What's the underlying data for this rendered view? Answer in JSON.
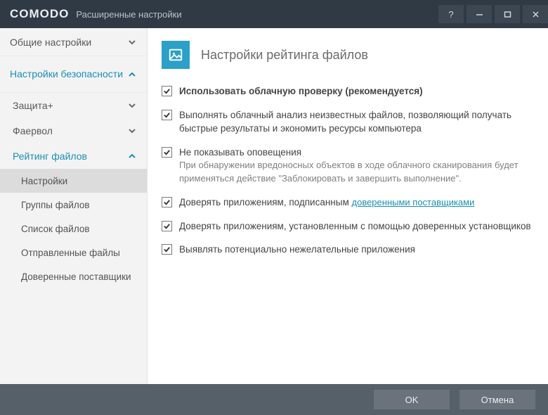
{
  "window": {
    "brand": "COMODO",
    "subtitle": "Расширенные настройки"
  },
  "sidebar": {
    "items": [
      {
        "label": "Общие настройки",
        "expanded": false,
        "active": false
      },
      {
        "label": "Настройки безопасности",
        "expanded": true,
        "active": true
      }
    ],
    "children": [
      {
        "label": "Защита+",
        "expanded": false,
        "active": false
      },
      {
        "label": "Фаервол",
        "expanded": false,
        "active": false
      },
      {
        "label": "Рейтинг файлов",
        "expanded": true,
        "active": true
      }
    ],
    "leaves": [
      {
        "label": "Настройки",
        "selected": true
      },
      {
        "label": "Группы файлов",
        "selected": false
      },
      {
        "label": "Список файлов",
        "selected": false
      },
      {
        "label": "Отправленные файлы",
        "selected": false
      },
      {
        "label": "Доверенные поставщики",
        "selected": false
      }
    ]
  },
  "page": {
    "title": "Настройки рейтинга файлов",
    "options": [
      {
        "label": "Использовать облачную проверку (рекомендуется)",
        "checked": true,
        "bold": true
      },
      {
        "label": "Выполнять облачный анализ неизвестных файлов, позволяющий получать быстрые результаты и экономить ресурсы компьютера",
        "checked": true
      },
      {
        "label": "Не показывать оповещения",
        "checked": true,
        "desc": "При обнаружении вредоносных объектов в ходе облачного сканирования будет применяться действие \"Заблокировать и завершить выполнение\"."
      },
      {
        "label_pre": "Доверять приложениям, подписанным ",
        "link": "доверенными поставщиками",
        "checked": true
      },
      {
        "label": "Доверять приложениям, установленным с помощью доверенных установщиков",
        "checked": true
      },
      {
        "label": "Выявлять потенциально нежелательные приложения",
        "checked": true
      }
    ]
  },
  "footer": {
    "ok": "OK",
    "cancel": "Отмена"
  }
}
